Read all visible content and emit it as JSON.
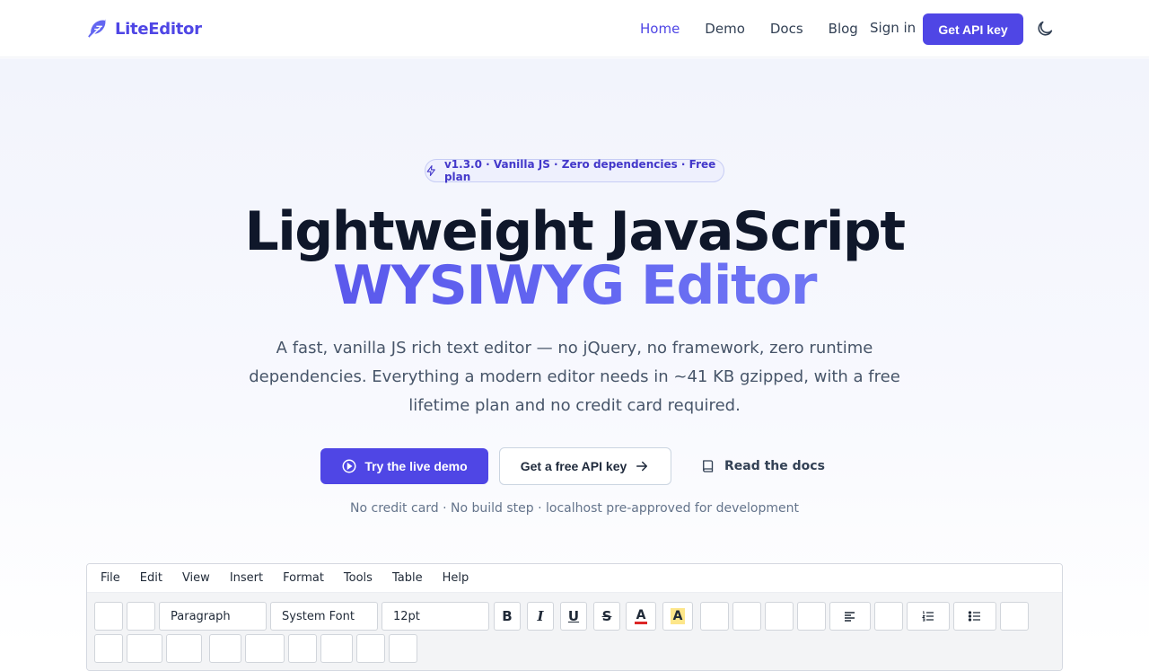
{
  "header": {
    "brand": "LiteEditor",
    "nav": [
      "Home",
      "Demo",
      "Docs",
      "Blog"
    ],
    "active_nav": "Home",
    "sign_in": "Sign in",
    "cta": "Get API key"
  },
  "hero": {
    "badge": "v1.3.0 · Vanilla JS · Zero dependencies · Free plan",
    "title_line1": "Lightweight JavaScript",
    "title_line2": "WYSIWYG Editor",
    "subtitle": "A fast, vanilla JS rich text editor — no jQuery, no framework, zero runtime dependencies. Everything a modern editor needs in ~41 KB gzipped, with a free lifetime plan and no credit card required.",
    "primary_cta": "Try the live demo",
    "secondary_cta": "Get a free API key",
    "docs_link": "Read the docs",
    "note": "No credit card · No build step · localhost pre-approved for development"
  },
  "editor": {
    "menu": [
      "File",
      "Edit",
      "View",
      "Insert",
      "Format",
      "Tools",
      "Table",
      "Help"
    ],
    "block_format": "Paragraph",
    "font_family": "System Font",
    "font_size": "12pt",
    "bold": "B",
    "italic": "I",
    "underline": "U",
    "strikethrough": "S",
    "font_color": "A",
    "highlight": "A"
  },
  "colors": {
    "accent": "#4f46e5",
    "text": "#0f172a",
    "muted": "#64748b"
  }
}
